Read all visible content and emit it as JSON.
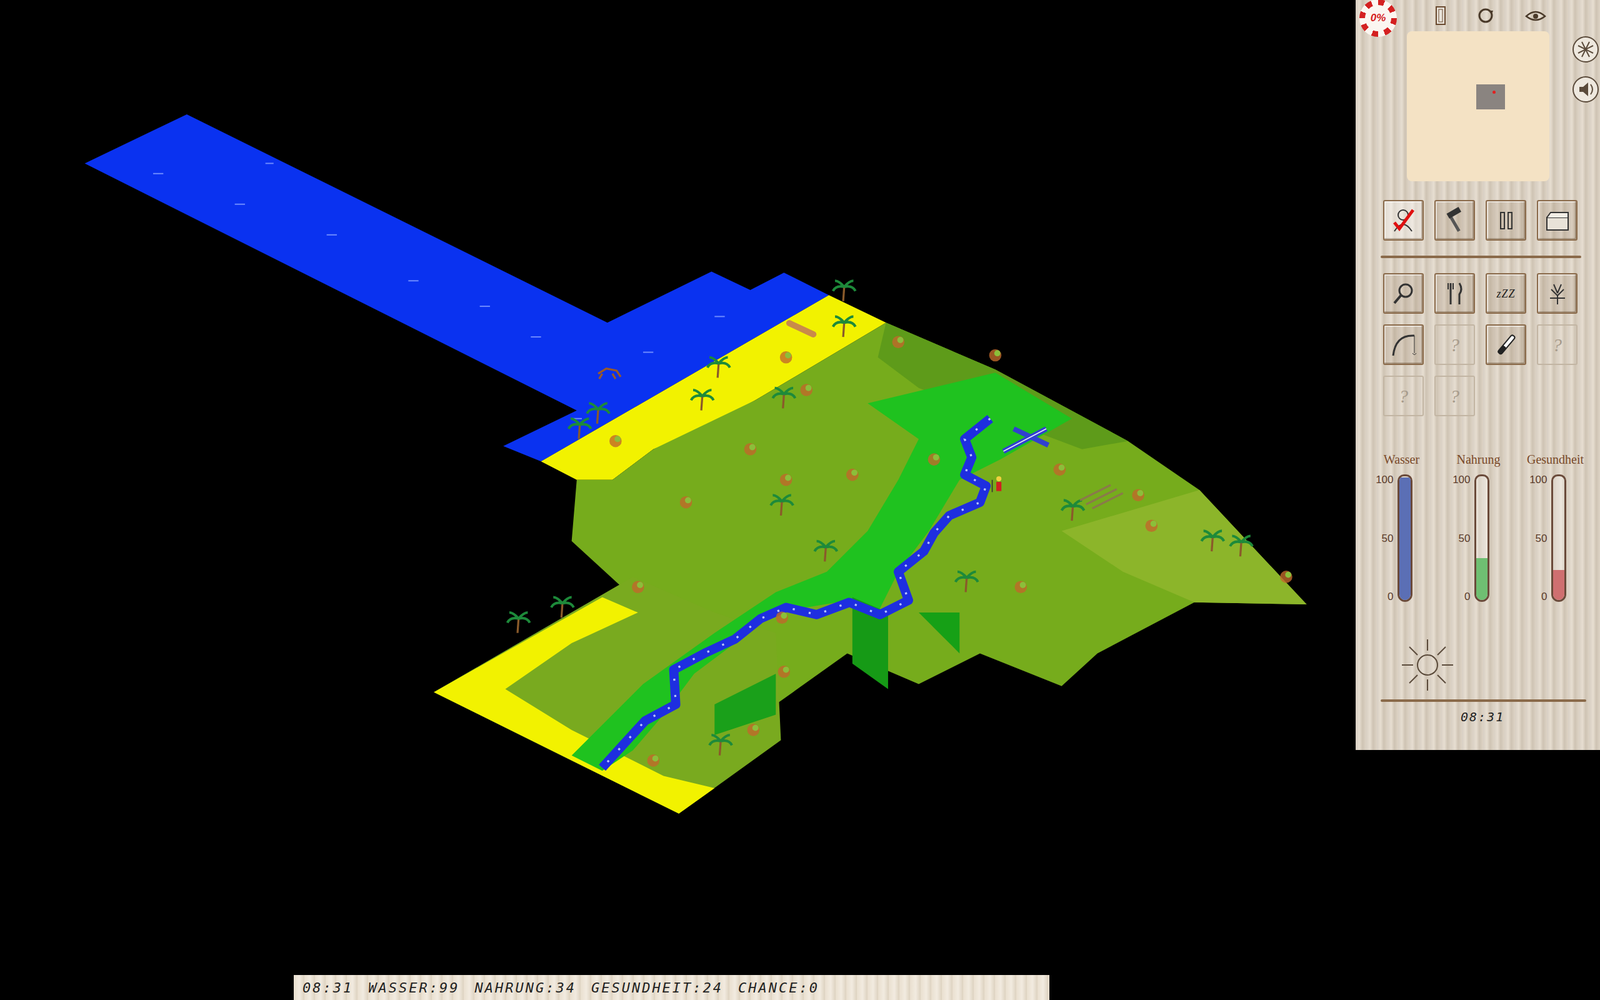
{
  "chance_badge": {
    "text": "0%"
  },
  "categories": [
    {
      "kind": "status",
      "selected": true
    },
    {
      "kind": "build",
      "selected": false
    },
    {
      "kind": "pause",
      "selected": false
    },
    {
      "kind": "inventory",
      "selected": false
    }
  ],
  "actions": [
    {
      "kind": "search",
      "label": "",
      "disabled": false
    },
    {
      "kind": "eat",
      "label": "",
      "disabled": false
    },
    {
      "kind": "sleep",
      "label": "zZZ",
      "disabled": false
    },
    {
      "kind": "look",
      "label": "",
      "disabled": false
    },
    {
      "kind": "fish",
      "label": "",
      "disabled": false
    },
    {
      "kind": "unknown",
      "label": "?",
      "disabled": true
    },
    {
      "kind": "knife",
      "label": "",
      "disabled": false
    },
    {
      "kind": "unknown",
      "label": "?",
      "disabled": true
    },
    {
      "kind": "unknown",
      "label": "?",
      "disabled": true
    },
    {
      "kind": "unknown",
      "label": "?",
      "disabled": true
    }
  ],
  "meters": [
    {
      "label": "Wasser",
      "level": 0.99,
      "color": "#5b6fb5"
    },
    {
      "label": "Nahrung",
      "level": 0.34,
      "color": "#6fbf72"
    },
    {
      "label": "Gesundheit",
      "level": 0.24,
      "color": "#cf6f70"
    }
  ],
  "meter_ticks": [
    "100",
    "50",
    "0"
  ],
  "clock": "08:31",
  "status_bar": {
    "items": [
      "08:31",
      "WASSER:99",
      "NAHRUNG:34",
      "GESUNDHEIT:24",
      "CHANCE:0"
    ]
  }
}
